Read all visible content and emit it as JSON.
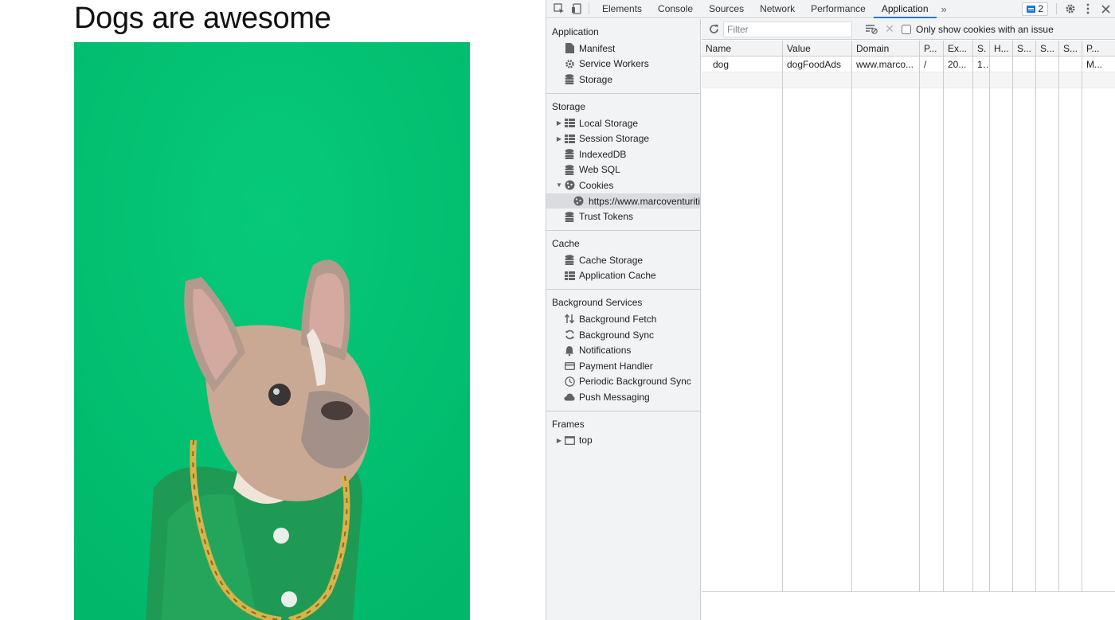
{
  "page": {
    "title": "Dogs are awesome"
  },
  "devtools": {
    "tabs": [
      "Elements",
      "Console",
      "Sources",
      "Network",
      "Performance",
      "Application"
    ],
    "active_tab": "Application",
    "issues_count": "2",
    "sidebar": {
      "application": {
        "heading": "Application",
        "items": [
          "Manifest",
          "Service Workers",
          "Storage"
        ]
      },
      "storage": {
        "heading": "Storage",
        "items": [
          "Local Storage",
          "Session Storage",
          "IndexedDB",
          "Web SQL",
          "Cookies",
          "https://www.marcoventuriti",
          "Trust Tokens"
        ]
      },
      "cache": {
        "heading": "Cache",
        "items": [
          "Cache Storage",
          "Application Cache"
        ]
      },
      "background": {
        "heading": "Background Services",
        "items": [
          "Background Fetch",
          "Background Sync",
          "Notifications",
          "Payment Handler",
          "Periodic Background Sync",
          "Push Messaging"
        ]
      },
      "frames": {
        "heading": "Frames",
        "items": [
          "top"
        ]
      }
    },
    "filter": {
      "placeholder": "Filter",
      "checkbox_label": "Only show cookies with an issue"
    },
    "cookies_table": {
      "columns": [
        "Name",
        "Value",
        "Domain",
        "P...",
        "Ex...",
        "S.",
        "H...",
        "S...",
        "S...",
        "S...",
        "P..."
      ],
      "rows": [
        [
          "dog",
          "dogFoodAds",
          "www.marco...",
          "/",
          "20...",
          "1...",
          "",
          "",
          "",
          "",
          "M..."
        ]
      ]
    }
  }
}
